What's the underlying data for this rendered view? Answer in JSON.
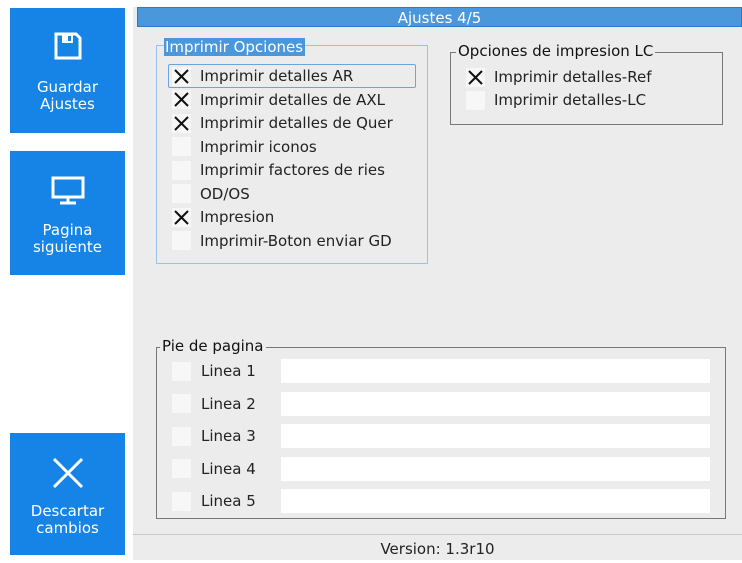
{
  "sidebar": {
    "save": {
      "label_line1": "Guardar",
      "label_line2": "Ajustes",
      "icon": "floppy-disk-icon"
    },
    "next": {
      "label_line1": "Pagina",
      "label_line2": "siguiente",
      "icon": "monitor-icon"
    },
    "discard": {
      "label_line1": "Descartar",
      "label_line2": "cambios",
      "icon": "close-icon"
    }
  },
  "header": {
    "title": "Ajustes 4/5"
  },
  "print_options": {
    "title": "Imprimir Opciones",
    "items": [
      {
        "label": "Imprimir detalles AR",
        "checked": true
      },
      {
        "label": "Imprimir detalles de AXL",
        "checked": true
      },
      {
        "label": "Imprimir detalles de Quer",
        "checked": true
      },
      {
        "label": "Imprimir iconos",
        "checked": false
      },
      {
        "label": "Imprimir factores de ries",
        "checked": false
      },
      {
        "label": "OD/OS",
        "checked": false
      },
      {
        "label": "Impresion",
        "checked": true
      },
      {
        "label": "Imprimir-Boton enviar GD",
        "checked": false
      }
    ]
  },
  "lc_options": {
    "title": "Opciones de impresion LC",
    "items": [
      {
        "label": "Imprimir detalles-Ref",
        "checked": true
      },
      {
        "label": "Imprimir detalles-LC",
        "checked": false
      }
    ]
  },
  "footer_section": {
    "title": "Pie de pagina",
    "lines": [
      {
        "label": "Linea 1",
        "checked": false,
        "value": ""
      },
      {
        "label": "Linea 2",
        "checked": false,
        "value": ""
      },
      {
        "label": "Linea 3",
        "checked": false,
        "value": ""
      },
      {
        "label": "Linea 4",
        "checked": false,
        "value": ""
      },
      {
        "label": "Linea 5",
        "checked": false,
        "value": ""
      }
    ]
  },
  "status": {
    "version": "Version: 1.3r10"
  },
  "colors": {
    "accent": "#1684e6",
    "title_bar": "#4a97db",
    "panel": "#ececec"
  }
}
